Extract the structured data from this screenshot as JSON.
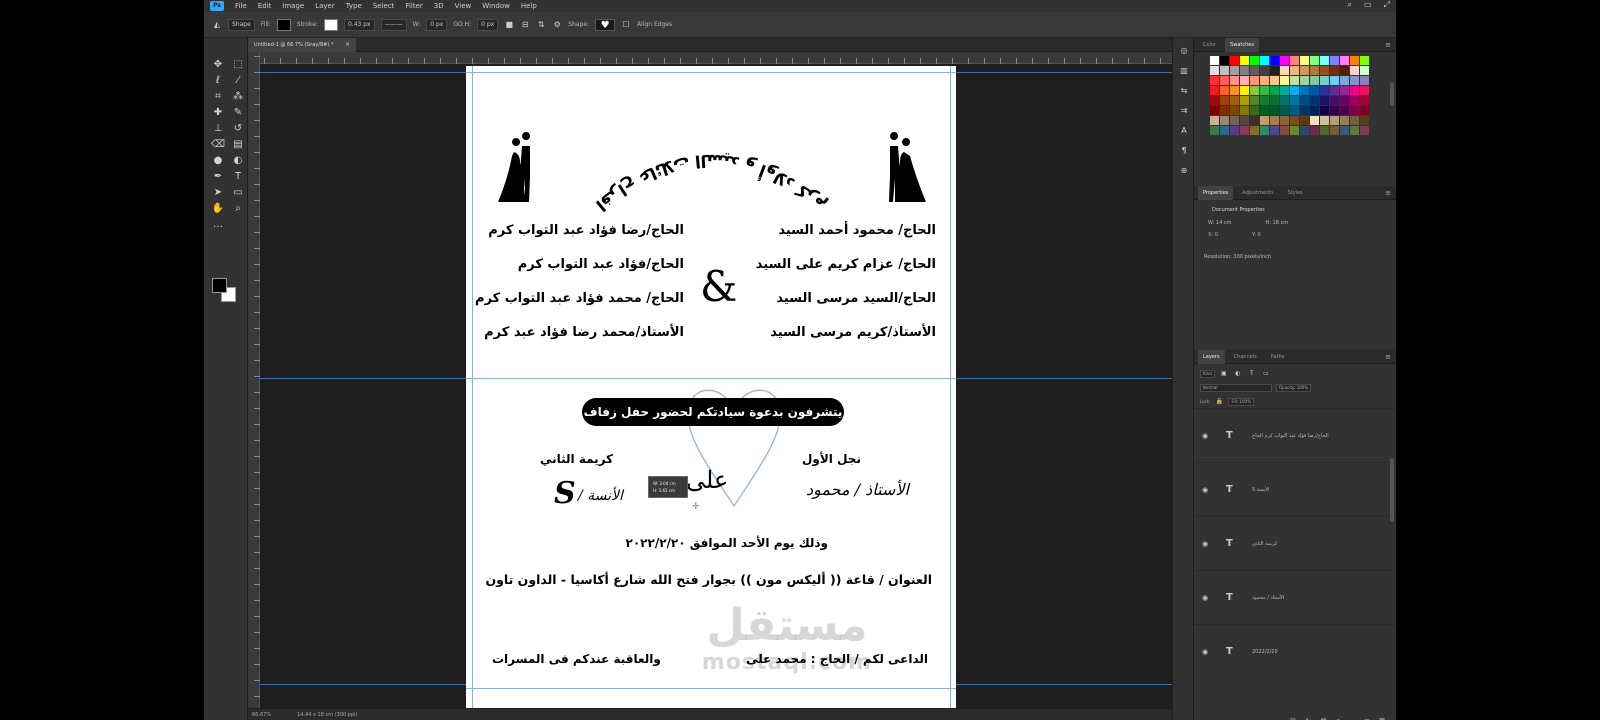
{
  "menu": {
    "logo": "Ps",
    "items": [
      "File",
      "Edit",
      "Image",
      "Layer",
      "Type",
      "Select",
      "Filter",
      "3D",
      "View",
      "Window",
      "Help"
    ]
  },
  "window_controls": [
    "⌕",
    "▭",
    "⤢"
  ],
  "options_bar": {
    "mode": "Shape",
    "fill_label": "Fill:",
    "stroke_label": "Stroke:",
    "stroke_width": "0.43 px",
    "w_label": "W:",
    "w_value": "0 px",
    "h_label": "GO H:",
    "h_value": "0 px",
    "shape_label": "Shape:",
    "align_edges": "Align Edges"
  },
  "document_tab": {
    "title": "Untitled-1 @ 66.7% (Gray/8#) *",
    "close": "×"
  },
  "status_bar": {
    "zoom": "66.67%",
    "doc_size": "14.44 x 18 cm (300 ppi)"
  },
  "invitation": {
    "title": "افراح عائلات السيد و أولاد كرم",
    "names_right": [
      "الحاج/ محمود أحمد السيد",
      "الحاج/ عزام كريم على السيد",
      "الحاج/السيد مرسى السيد",
      "الأستاذ/كريم مرسى السيد"
    ],
    "names_left": [
      "الحاج/رضا فؤاد عبد التواب كرم",
      "الحاج/فؤاد عبد التواب كرم",
      "الحاج/ محمد فؤاد عبد التواب كرم",
      "الأستاذ/محمد رضا فؤاد عبد كرم"
    ],
    "ampersand": "&",
    "banner": "يتشرفون بدعوة سيادتكم لحضور حفل زفاف",
    "groom_label": "نجل الأول",
    "groom_name": "الأستاذ / محمود",
    "bride_label": "كريمة الثاني",
    "bride_name": "الأنسة /",
    "bride_initial": "S",
    "ali": "على",
    "tooltip_line1": "W: 3.04 cm",
    "tooltip_line2": "H: 3.65 cm",
    "date_line": "وذلك يوم الأحد الموافق ٢٠٢٢/٢/٢٠",
    "address_line": "العنوان / قاعة (( أليكس مون )) بجوار فتح الله شارع أكاسيا - الداون تاون",
    "footer_right": "الداعى لكم / الحاج : محمد على",
    "footer_left": "والعاقبة عندكم فى المسرات"
  },
  "watermark": {
    "arabic": "مستقل",
    "latin": "mostaql.com"
  },
  "panels": {
    "color_tabs": [
      "Color",
      "Swatches"
    ],
    "properties_tabs": [
      "Properties",
      "Adjustments",
      "Styles"
    ],
    "properties_title": "Document Properties",
    "props_w": "W: 14 cm",
    "props_h": "H: 18 cm",
    "props_x": "X: 0",
    "props_y": "Y: 0",
    "resolution": "Resolution: 300 pixels/inch",
    "layers_tabs": [
      "Layers",
      "Channels",
      "Paths"
    ],
    "layers_filter": "Kind",
    "layers_blend": "Normal",
    "layers_opacity": "Opacity: 100%",
    "layers_lock": "Lock:",
    "layers_fill": "Fill: 100%",
    "layers": [
      "الحاج/رضا فؤاد عبد التواب كرم الحاج",
      "الأنسة S",
      "كريمة الثاني",
      "الأستاذ / محمود",
      "2022/2/20"
    ]
  },
  "colors": {
    "photoshop_blue": "#31a8ff",
    "guide_blue": "#3d6fa8",
    "banner_black": "#000000"
  },
  "swatches": [
    "#ffffff",
    "#000000",
    "#ff0000",
    "#ffff00",
    "#00ff00",
    "#00ffff",
    "#0000ff",
    "#ff00ff",
    "#ff8080",
    "#ffff80",
    "#80ff80",
    "#80ffff",
    "#8080ff",
    "#ff80ff",
    "#ff8000",
    "#80ff00",
    "#e0e0e0",
    "#c0c0c0",
    "#a0a0a0",
    "#808080",
    "#606060",
    "#404040",
    "#202020",
    "#f8d8b8",
    "#e8b888",
    "#d09860",
    "#b07840",
    "#905020",
    "#703010",
    "#502000",
    "#ffd0d0",
    "#d0ffd0",
    "#ff3030",
    "#ff6060",
    "#ff9090",
    "#ffb0b0",
    "#f7977a",
    "#f9ad81",
    "#fdc68a",
    "#fff79a",
    "#c4df9b",
    "#a2d39c",
    "#82ca9d",
    "#7bcdc8",
    "#6ecff6",
    "#7ea7d8",
    "#8493ca",
    "#8882be",
    "#ed1c24",
    "#f26522",
    "#f7941d",
    "#fff200",
    "#8dc63f",
    "#39b54a",
    "#00a651",
    "#00a99d",
    "#00aeef",
    "#0072bc",
    "#0054a6",
    "#2e3192",
    "#662d91",
    "#92278f",
    "#ec008c",
    "#ed145b",
    "#9e0b0f",
    "#a0410d",
    "#a36209",
    "#aba000",
    "#598527",
    "#197b30",
    "#007236",
    "#00746b",
    "#0076a3",
    "#004b80",
    "#003471",
    "#1b1464",
    "#440e62",
    "#630460",
    "#9e005d",
    "#9e0039",
    "#790000",
    "#7b2e00",
    "#7d4900",
    "#827b00",
    "#406618",
    "#005e20",
    "#005826",
    "#005952",
    "#005b7f",
    "#003663",
    "#002157",
    "#0d004c",
    "#32004b",
    "#4b0049",
    "#7b0046",
    "#7a0026",
    "#c7b299",
    "#998675",
    "#736357",
    "#534741",
    "#37302d",
    "#c69c6d",
    "#a67c52",
    "#8c6239",
    "#754c24",
    "#603913",
    "#f0e0c0",
    "#d0c0a0",
    "#b0a080",
    "#908060",
    "#706040",
    "#504020",
    "#3a7a4a",
    "#2a6a8a",
    "#5a3a8a",
    "#8a3a5a",
    "#8a6a2a",
    "#2a8a6a",
    "#4a4a8a",
    "#8a4a4a",
    "#6a8a2a",
    "#2a4a6a",
    "#6a2a4a",
    "#4a6a2a",
    "#7a5a3a",
    "#3a5a7a",
    "#5a7a3a",
    "#7a3a5a"
  ]
}
